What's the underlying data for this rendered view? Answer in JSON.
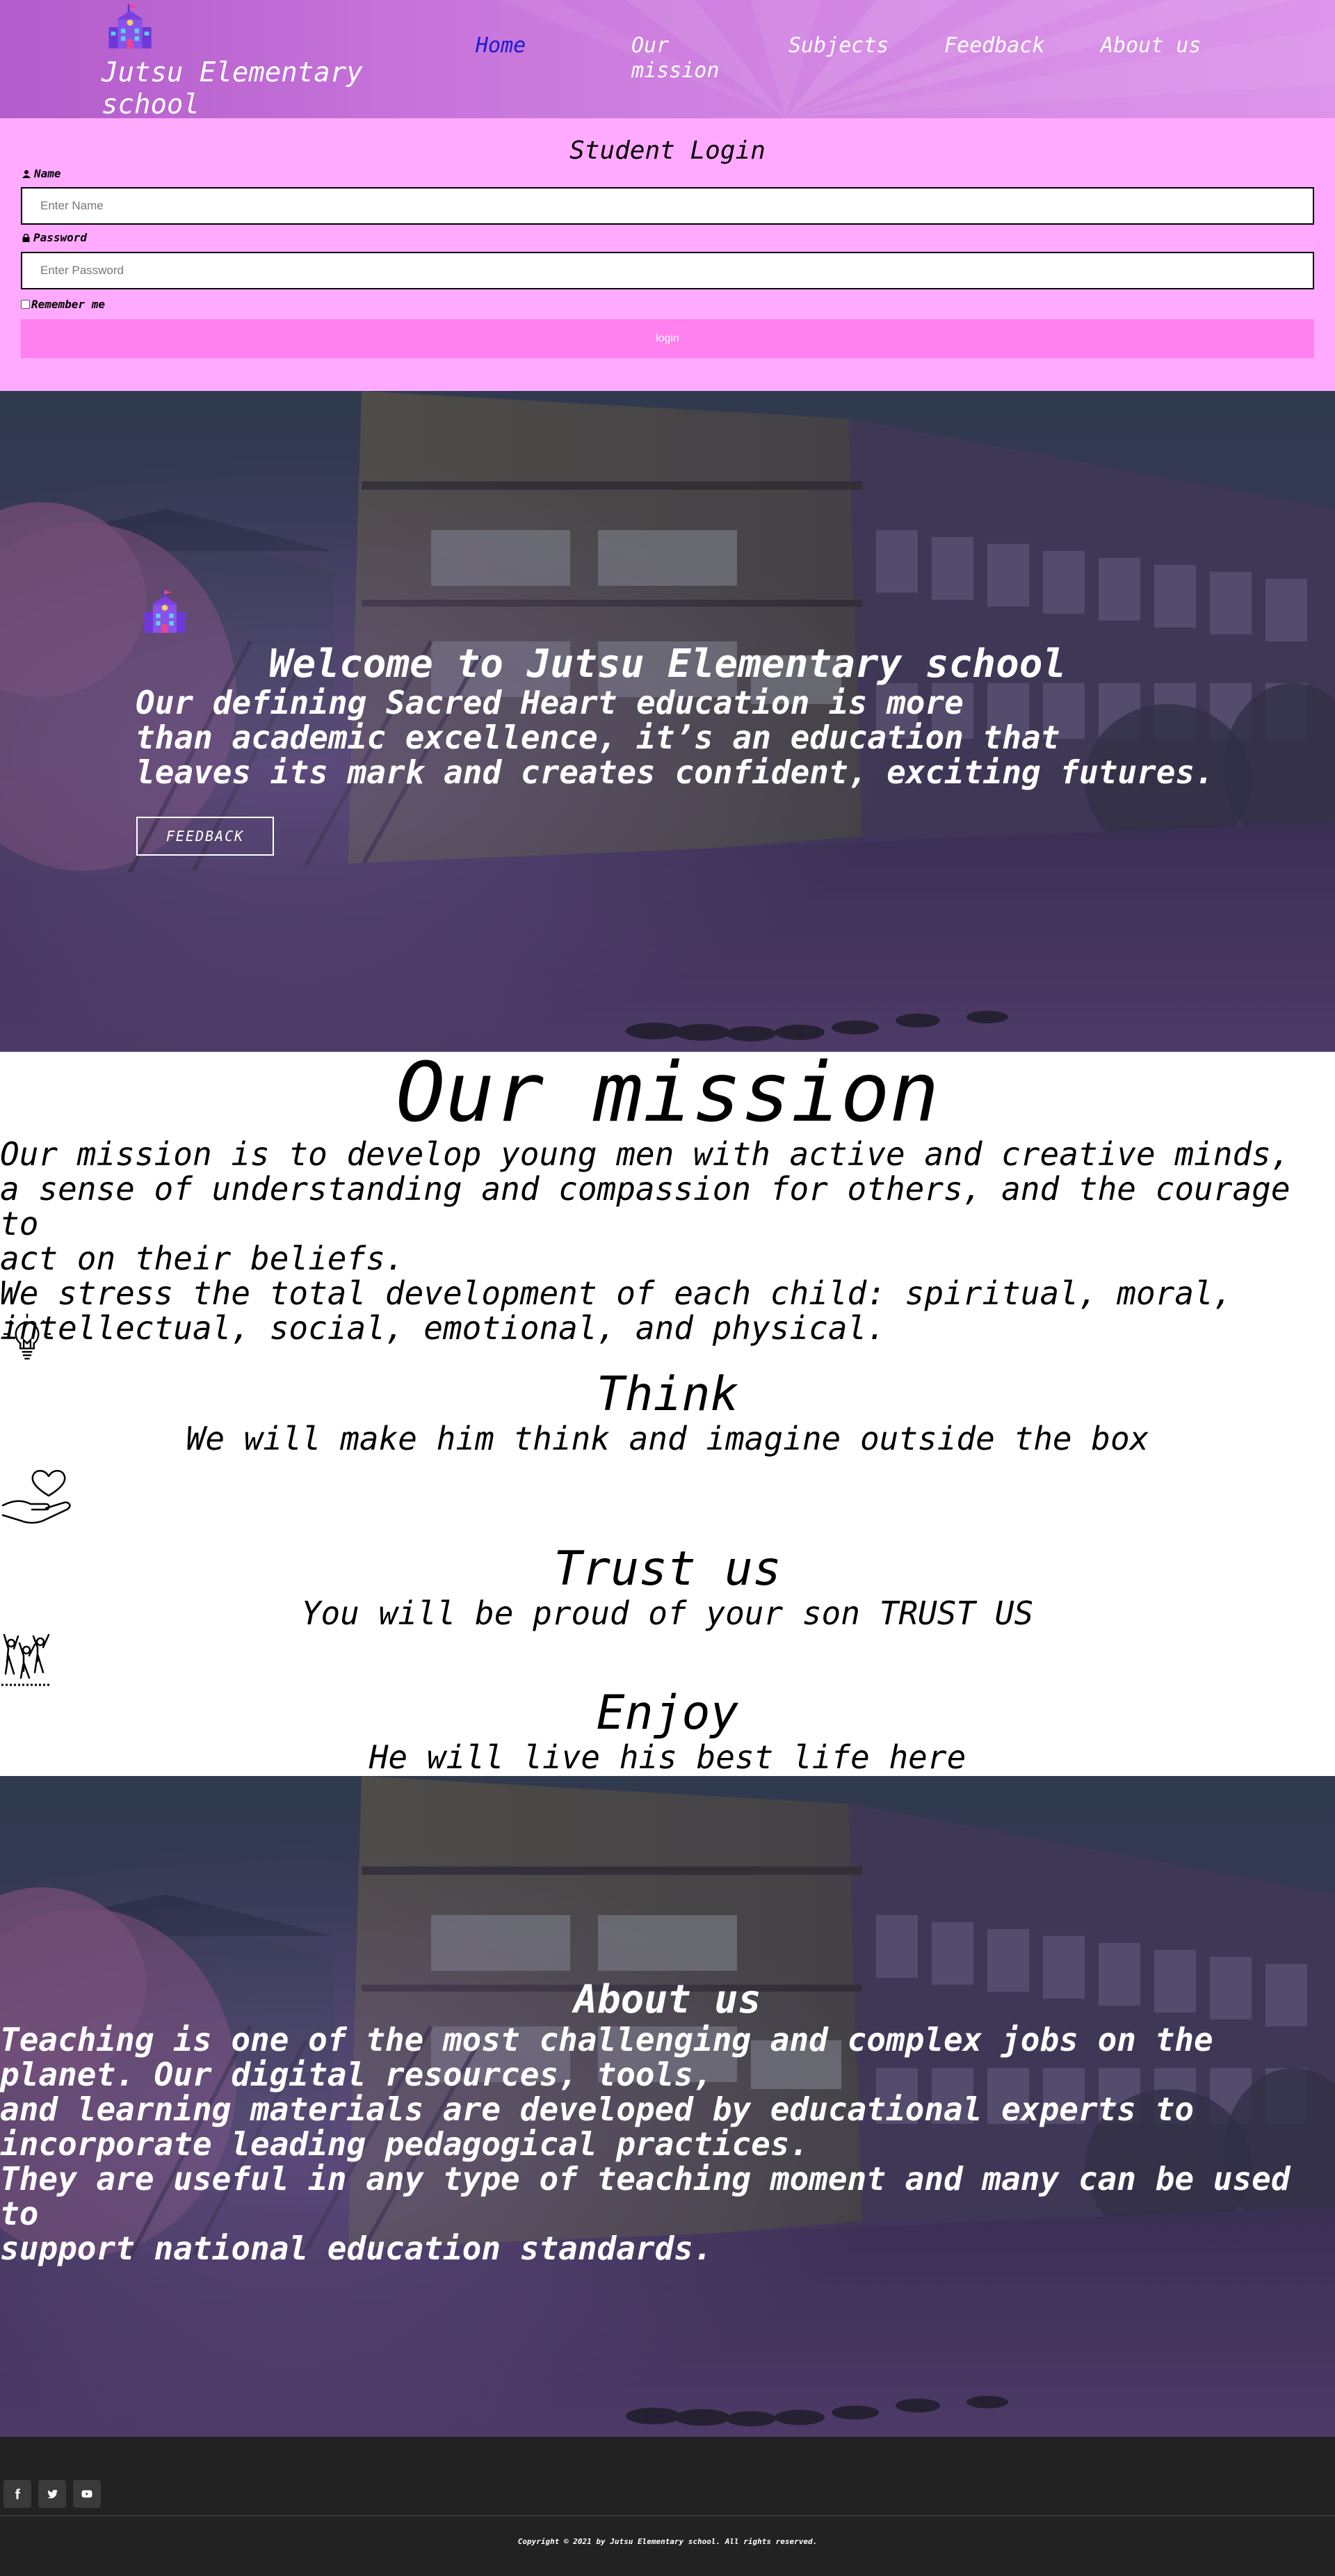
{
  "header": {
    "brand": "Jutsu Elementary\nschool",
    "nav": [
      {
        "label": "Home",
        "active": true
      },
      {
        "label": "Our\nmission",
        "active": false
      },
      {
        "label": "Subjects",
        "active": false
      },
      {
        "label": "Feedback",
        "active": false
      },
      {
        "label": "About us",
        "active": false
      }
    ],
    "colors": {
      "gradient_start": "#b35ccc",
      "gradient_end": "#dc95ea",
      "active_nav": "#1a1ad6"
    }
  },
  "login": {
    "title": "Student Login",
    "name_label": "Name",
    "name_placeholder": "Enter Name",
    "password_label": "Password",
    "password_placeholder": "Enter Password",
    "remember_label": "Remember me",
    "button_label": "login",
    "colors": {
      "background": "#ffaaff",
      "button": "#ff80ee"
    }
  },
  "hero": {
    "title": "Welcome to Jutsu Elementary school",
    "subtitle": "Our defining Sacred Heart education is more\nthan academic excellence, it’s an education that\nleaves its mark and creates confident, exciting futures.",
    "button_label": "FEEDBACK"
  },
  "mission": {
    "title": "Our mission",
    "text": "Our mission is to develop young men with active and creative minds,\na sense of understanding and compassion for others, and the courage to\nact on their beliefs.\nWe stress the total development of each child: spiritual, moral,\nintellectual, social, emotional, and physical.",
    "features": [
      {
        "icon": "lightbulb-icon",
        "title": "Think",
        "text": "We will make him think and imagine outside the box"
      },
      {
        "icon": "heart-hand-icon",
        "title": "Trust us",
        "text": "You will be proud of your son TRUST US"
      },
      {
        "icon": "people-celebrating-icon",
        "title": "Enjoy",
        "text": "He will live his best life here"
      }
    ]
  },
  "about": {
    "title": "About us",
    "text": "Teaching is one of the most challenging and complex jobs on the\nplanet. Our digital resources, tools,\nand learning materials are developed by educational experts to\nincorporate leading pedagogical practices.\nThey are useful in any type of teaching moment and many can be used to\nsupport national education standards."
  },
  "footer": {
    "social": [
      "facebook-icon",
      "twitter-icon",
      "youtube-icon"
    ],
    "copyright": "Copyright © 2021 by Jutsu Elementary school. All rights reserved.",
    "colors": {
      "background": "#222222"
    }
  }
}
